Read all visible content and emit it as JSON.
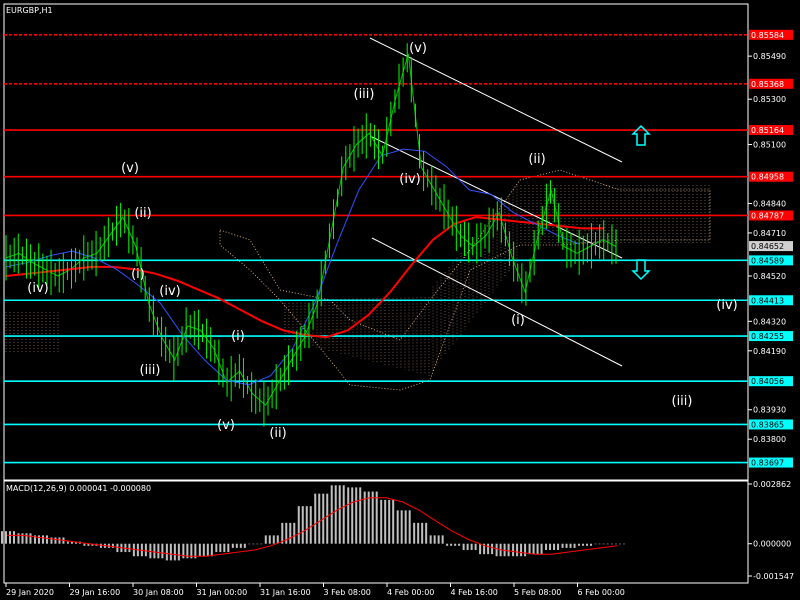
{
  "chart_data": {
    "type": "line",
    "title": "EURGBP,H1",
    "symbol": "EURGBP",
    "timeframe": "H1",
    "price_axis": {
      "ylim": [
        0.8362,
        0.8572
      ],
      "ticks": [
        "0.85490",
        "0.85300",
        "0.85100",
        "0.84840",
        "0.84710",
        "0.84520",
        "0.84320",
        "0.84190",
        "0.83930",
        "0.83800"
      ]
    },
    "time_axis": {
      "labels": [
        "29 Jan 2020",
        "29 Jan 16:00",
        "30 Jan 08:00",
        "31 Jan 00:00",
        "31 Jan 16:00",
        "3 Feb 08:00",
        "4 Feb 00:00",
        "4 Feb 16:00",
        "5 Feb 08:00",
        "6 Feb 00:00"
      ]
    },
    "current_price": "0.84652",
    "levels": [
      {
        "price": "0.85584",
        "color": "#ff0000",
        "style": "dotted"
      },
      {
        "price": "0.85368",
        "color": "#ff0000",
        "style": "dotted"
      },
      {
        "price": "0.85164",
        "color": "#ff0000",
        "style": "solid"
      },
      {
        "price": "0.84958",
        "color": "#ff0000",
        "style": "solid"
      },
      {
        "price": "0.84787",
        "color": "#ff0000",
        "style": "solid"
      },
      {
        "price": "0.84589",
        "color": "#00ffff",
        "style": "solid"
      },
      {
        "price": "0.84413",
        "color": "#00ffff",
        "style": "solid"
      },
      {
        "price": "0.84255",
        "color": "#00ffff",
        "style": "solid"
      },
      {
        "price": "0.84056",
        "color": "#00ffff",
        "style": "solid"
      },
      {
        "price": "0.83865",
        "color": "#00ffff",
        "style": "solid"
      },
      {
        "price": "0.83697",
        "color": "#00ffff",
        "style": "solid"
      }
    ],
    "wave_labels": [
      "(iv)",
      "(v)",
      "(ii)",
      "(i)",
      "(iv)",
      "(iii)",
      "(i)",
      "(v)",
      "(ii)",
      "(iii)",
      "(v)",
      "(iv)",
      "(ii)",
      "(i)",
      "(iv)",
      "(iii)"
    ],
    "series": [
      {
        "type": "line",
        "color": "#00c000",
        "values": [
          0.846,
          0.8462,
          0.8458,
          0.8455,
          0.8452,
          0.8455,
          0.846,
          0.8462,
          0.847,
          0.8478,
          0.8465,
          0.844,
          0.8425,
          0.8415,
          0.843,
          0.8428,
          0.842,
          0.8405,
          0.841,
          0.84,
          0.8395,
          0.8405,
          0.8415,
          0.8425,
          0.844,
          0.847,
          0.85,
          0.851,
          0.8515,
          0.8505,
          0.853,
          0.855,
          0.85,
          0.849,
          0.848,
          0.847,
          0.8465,
          0.847,
          0.848,
          0.846,
          0.8445,
          0.847,
          0.849,
          0.8465,
          0.8462,
          0.8465,
          0.8468,
          0.8465
        ]
      },
      {
        "type": "line",
        "color": "#ff0000",
        "values": [
          0.8452,
          0.8453,
          0.8454,
          0.8455,
          0.8456,
          0.8456,
          0.8455,
          0.8453,
          0.845,
          0.8446,
          0.8442,
          0.8437,
          0.8432,
          0.8428,
          0.8426,
          0.8425,
          0.8428,
          0.8435,
          0.8445,
          0.8457,
          0.8468,
          0.8475,
          0.8478,
          0.8477,
          0.8476,
          0.8475,
          0.8474,
          0.8473,
          0.8473
        ]
      },
      {
        "type": "line",
        "color": "#3050ff",
        "values": [
          0.8456,
          0.8458,
          0.8461,
          0.8463,
          0.846,
          0.8455,
          0.8448,
          0.844,
          0.8426,
          0.8415,
          0.8406,
          0.8404,
          0.8408,
          0.842,
          0.844,
          0.8466,
          0.849,
          0.8505,
          0.8508,
          0.8507,
          0.85,
          0.849,
          0.8488,
          0.848,
          0.8475,
          0.847,
          0.8466
        ]
      }
    ]
  },
  "macd": {
    "title": "MACD(12,26,9) 0.000041 -0.000080",
    "ticks": [
      "0.002862",
      "0.000000",
      "-0.001547"
    ],
    "histogram": [
      0.0006,
      0.0005,
      0.0004,
      0.0003,
      0.0001,
      -0.0001,
      -0.0002,
      -0.0004,
      -0.0006,
      -0.0007,
      -0.0008,
      -0.0007,
      -0.0006,
      -0.0004,
      -0.0002,
      0.0,
      0.0004,
      0.001,
      0.0018,
      0.0024,
      0.0028,
      0.0027,
      0.0025,
      0.0021,
      0.0016,
      0.001,
      0.0004,
      -0.0001,
      -0.0003,
      -0.0005,
      -0.0006,
      -0.0006,
      -0.0005,
      -0.0003,
      -0.0002,
      -0.0001,
      0.0,
      0.0
    ],
    "signal": [
      0.0004,
      0.0004,
      0.0003,
      0.0002,
      0.0001,
      0.0,
      -0.0001,
      -0.0002,
      -0.0003,
      -0.0004,
      -0.0005,
      -0.0006,
      -0.0006,
      -0.0005,
      -0.0004,
      -0.0003,
      -0.0001,
      0.0002,
      0.0006,
      0.0011,
      0.0016,
      0.002,
      0.0022,
      0.0022,
      0.002,
      0.0016,
      0.0011,
      0.0006,
      0.0002,
      -0.0001,
      -0.0003,
      -0.0004,
      -0.0005,
      -0.0005,
      -0.0004,
      -0.0003,
      -0.0002,
      -0.0001
    ]
  }
}
